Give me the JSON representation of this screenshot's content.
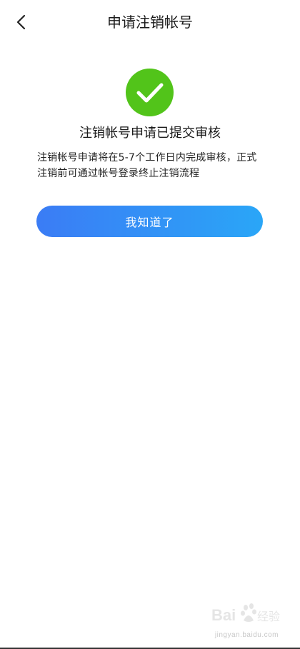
{
  "header": {
    "title": "申请注销帐号",
    "back_icon": "chevron-left-icon"
  },
  "result": {
    "icon": "check-circle-icon",
    "icon_color": "#52c41a",
    "title": "注销帐号申请已提交审核",
    "description": "注销帐号申请将在5-7个工作日内完成审核，正式注销前可通过帐号登录终止注销流程"
  },
  "actions": {
    "confirm_label": "我知道了",
    "gradient_start": "#3b7cf5",
    "gradient_end": "#2aa6f7"
  },
  "watermark": {
    "logo_text": "Bai 经验",
    "url": "jingyan.baidu.com"
  }
}
